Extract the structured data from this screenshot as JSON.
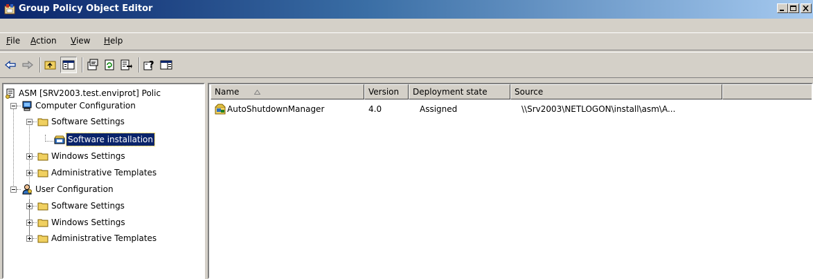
{
  "window": {
    "title": "Group Policy Object Editor"
  },
  "menu": [
    {
      "label": "File",
      "accel": "F",
      "rest": "ile"
    },
    {
      "label": "Action",
      "accel": "A",
      "rest": "ction"
    },
    {
      "label": "View",
      "accel": "V",
      "rest": "iew"
    },
    {
      "label": "Help",
      "accel": "H",
      "rest": "elp"
    }
  ],
  "toolbar": {
    "icons": [
      "back-arrow-icon",
      "forward-arrow-icon",
      "up-folder-icon",
      "show-hide-tree-icon",
      "properties-icon",
      "refresh-icon",
      "export-list-icon",
      "help-icon",
      "action-pane-icon"
    ]
  },
  "tree": {
    "root": "ASM [SRV2003.test.enviprot] Polic",
    "computer_config": "Computer Configuration",
    "cc_software_settings": "Software Settings",
    "cc_software_installation": "Software installation",
    "cc_windows_settings": "Windows Settings",
    "cc_admin_templates": "Administrative Templates",
    "user_config": "User Configuration",
    "uc_software_settings": "Software Settings",
    "uc_windows_settings": "Windows Settings",
    "uc_admin_templates": "Administrative Templates"
  },
  "list": {
    "columns": [
      "Name",
      "Version",
      "Deployment state",
      "Source"
    ],
    "rows": [
      {
        "name": "AutoShutdownManager",
        "version": "4.0",
        "state": "Assigned",
        "source": "\\\\Srv2003\\NETLOGON\\install\\asm\\A..."
      }
    ]
  },
  "colors": {
    "titlebar_start": "#0a246a",
    "titlebar_end": "#a6caf0",
    "selection": "#0a246a",
    "face": "#d4d0c8"
  }
}
